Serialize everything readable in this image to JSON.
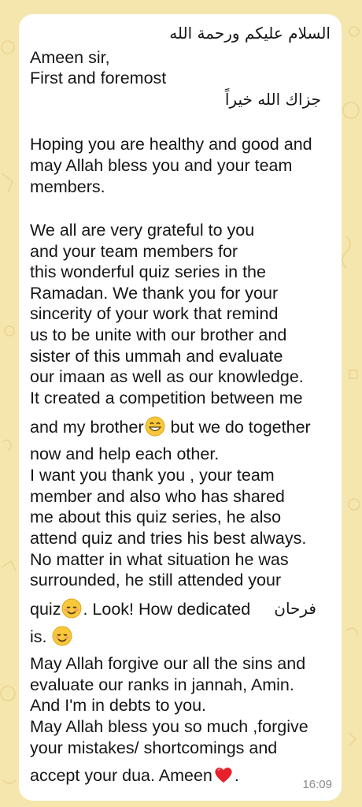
{
  "message": {
    "greeting_arabic": "السلام عليكم ورحمة الله",
    "line_1": "Ameen sir,",
    "line_2": "First and foremost",
    "thanks_arabic": "جزاك الله خيراً",
    "paragraph_1": [
      "Hoping you are healthy and good and",
      "may Allah bless you and your team",
      "members."
    ],
    "paragraph_2": [
      "We all are very grateful to you",
      "and your team members for",
      "this wonderful quiz series in the",
      "Ramadan. We thank you for your",
      "sincerity of your work that remind",
      "us to be unite with our brother and",
      "sister of this ummah and evaluate",
      "our imaan as well as our knowledge.",
      "It created a competition between me"
    ],
    "brother_line_before": "and my brother",
    "brother_line_after": " but we do together",
    "paragraph_2b": [
      "now and help each other.",
      "I want you thank you , your team",
      "member and also who has shared",
      "me about this quiz series, he also",
      "attend quiz and tries his best always.",
      "No matter in what situation he was",
      "surrounded, he still attended your"
    ],
    "quiz_line_before": "quiz",
    "quiz_line_after": ". Look! How dedicated",
    "name_arabic": "فرحان",
    "is_line": "is.",
    "paragraph_3": [
      "May Allah forgive our all the sins and",
      "evaluate our ranks in jannah, Amin.",
      "And I'm in debts to you.",
      "May Allah bless you so much ,forgive",
      "your mistakes/ shortcomings and"
    ],
    "last_line_before": "accept your dua. Ameen",
    "last_line_after": ".",
    "time": "16:09"
  },
  "emojis": [
    "grinning-face-emoji",
    "smiling-face-emoji",
    "smiling-face-emoji",
    "red-heart-emoji"
  ],
  "colors": {
    "background": "#f5e6ad",
    "bubble": "#ffffff",
    "text": "#161616",
    "timestamp": "#8a8a8a"
  }
}
